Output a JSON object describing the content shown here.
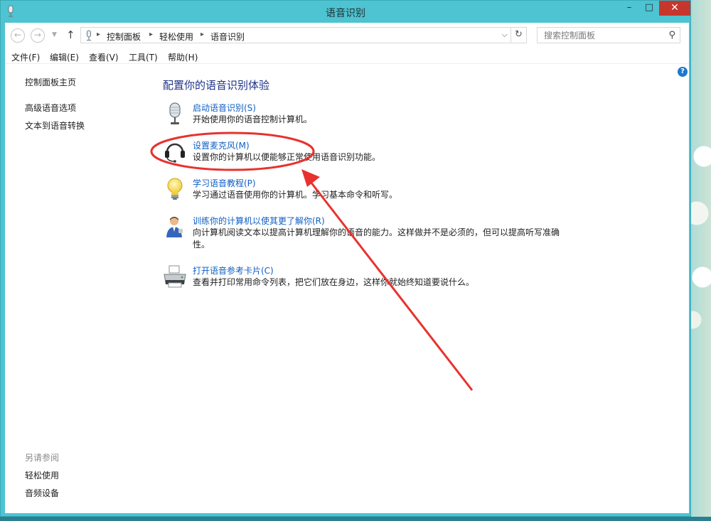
{
  "window": {
    "title": "语音识别",
    "min_glyph": "–",
    "max_glyph": "□",
    "close_glyph": "✕"
  },
  "nav": {
    "back_glyph": "←",
    "forward_glyph": "→",
    "recent_glyph": "▼",
    "up_glyph": "↑",
    "breadcrumbs": [
      "控制面板",
      "轻松使用",
      "语音识别"
    ],
    "separator_glyph": "▸",
    "dropdown_glyph": "⌵",
    "refresh_glyph": "↻"
  },
  "search": {
    "placeholder": "搜索控制面板",
    "icon_glyph": "⚲"
  },
  "menu": {
    "items": [
      "文件(F)",
      "编辑(E)",
      "查看(V)",
      "工具(T)",
      "帮助(H)"
    ]
  },
  "sidebar": {
    "home": "控制面板主页",
    "links": [
      "高级语音选项",
      "文本到语音转换"
    ],
    "see_also_label": "另请参阅",
    "see_also": [
      "轻松使用",
      "音频设备"
    ]
  },
  "help": {
    "glyph": "?"
  },
  "main": {
    "title": "配置你的语音识别体验",
    "tasks": [
      {
        "icon": "microphone-icon",
        "link": "启动语音识别(S)",
        "desc": "开始使用你的语音控制计算机。"
      },
      {
        "icon": "headset-icon",
        "link": "设置麦克风(M)",
        "desc": "设置你的计算机以便能够正常使用语音识别功能。"
      },
      {
        "icon": "lightbulb-icon",
        "link": "学习语音教程(P)",
        "desc": "学习通过语音使用你的计算机。学习基本命令和听写。"
      },
      {
        "icon": "person-icon",
        "link": "训练你的计算机以使其更了解你(R)",
        "desc": "向计算机阅读文本以提高计算机理解你的语音的能力。这样做并不是必须的，但可以提高听写准确性。"
      },
      {
        "icon": "printer-icon",
        "link": "打开语音参考卡片(C)",
        "desc": "查看并打印常用命令列表，把它们放在身边，这样你就始终知道要说什么。"
      }
    ]
  },
  "annotation": {
    "color": "#e8322e"
  }
}
